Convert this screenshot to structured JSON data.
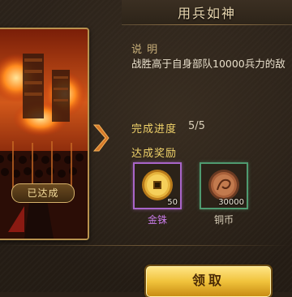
{
  "header": {
    "title": "用兵如神"
  },
  "achievement": {
    "status_badge": "已达成",
    "description_label": "说  明",
    "description": "战胜高于自身部队10000兵力的敌",
    "progress_label": "完成进度",
    "progress_value": "5/5",
    "reward_label": "达成奖励"
  },
  "rewards": [
    {
      "name": "金铢",
      "count": "50",
      "icon": "gold-coin-icon",
      "rarity_color": "#a865c8"
    },
    {
      "name": "铜币",
      "count": "30000",
      "icon": "copper-coin-icon",
      "rarity_color": "#4f9a70"
    }
  ],
  "actions": {
    "claim_label": "领取"
  }
}
